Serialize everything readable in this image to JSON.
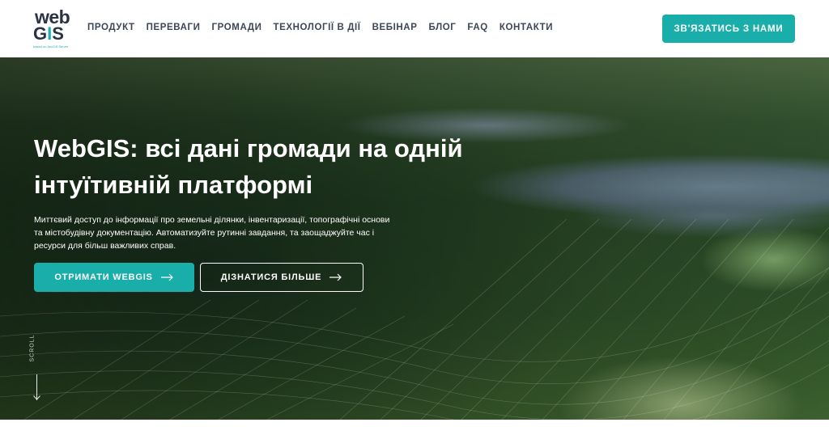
{
  "logo": {
    "top": "web",
    "bottom_g": "G",
    "bottom_i": "I",
    "bottom_s": "S",
    "tagline": "based on ArcGIS Server"
  },
  "nav": [
    "ПРОДУКТ",
    "ПЕРЕВАГИ",
    "ГРОМАДИ",
    "ТЕХНОЛОГІЇ В ДІЇ",
    "ВЕБІНАР",
    "БЛОГ",
    "FAQ",
    "КОНТАКТИ"
  ],
  "header_cta": "ЗВ'ЯЗАТИСЬ З НАМИ",
  "hero": {
    "title": "WebGIS: всі дані громади на одній інтуїтивній платформі",
    "description": "Миттєвий доступ до інформації про земельні ділянки, інвентаризації, топографічні основи та містобудівну документацію. Автоматизуйте рутинні завдання, та заощаджуйте час і ресурси для більш важливих справ.",
    "primary_button": "ОТРИМАТИ WEBGIS",
    "secondary_button": "ДІЗНАТИСЯ БІЛЬШЕ",
    "scroll_label": "SCROLL"
  },
  "colors": {
    "accent": "#1aaeaa",
    "nav_text": "#3c4657",
    "logo_dark": "#2a3344"
  },
  "icons": {
    "button_arrow": "arrow-right-icon",
    "scroll": "scroll-down-icon"
  }
}
